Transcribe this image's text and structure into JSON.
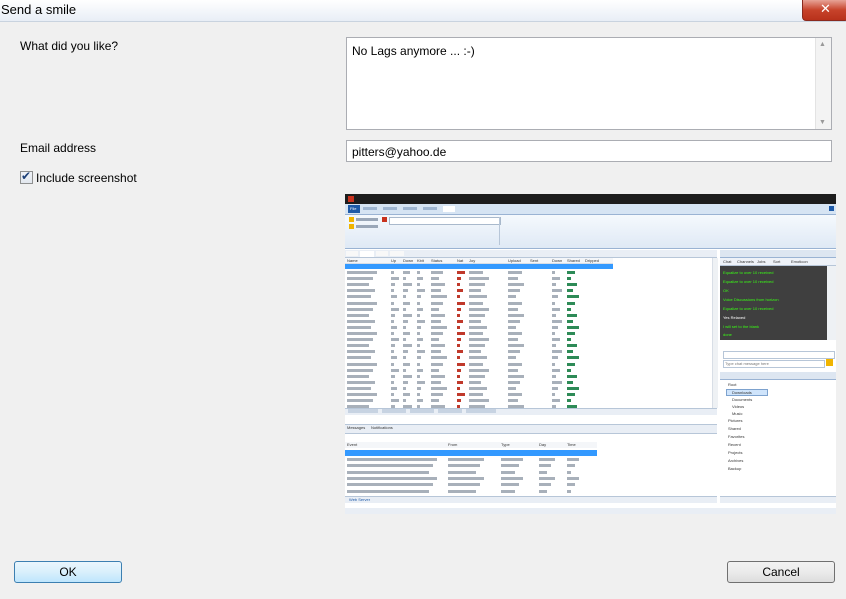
{
  "window": {
    "title": "Send a smile",
    "close_glyph": "✕"
  },
  "form": {
    "like_label": "What did you like?",
    "like_value": "No Lags anymore ... :-)",
    "email_label": "Email address",
    "email_value": "pitters@yahoo.de",
    "include_screenshot_label": "Include screenshot",
    "include_screenshot_checked": true
  },
  "buttons": {
    "ok": "OK",
    "cancel": "Cancel"
  },
  "screenshot": {
    "ribbon_tab_active": "File",
    "panel_tabs": [
      "Chat",
      "Channels",
      "Jobs",
      "Sort",
      "Emoticon"
    ],
    "table_headers": [
      "Name",
      "Up",
      "Down",
      "Kbit",
      "Status",
      "Nat",
      "Joy",
      "Upload",
      "Sent",
      "Down",
      "Shared",
      "Dripped"
    ],
    "chat_lines": [
      "Equalize to over 10 received",
      "Equalize to over 10 received",
      "OK",
      "Voice Discussions from horizon",
      "Equalize to over 10 received",
      "Yes Relaxed",
      "I will set to the blank",
      "done"
    ],
    "chat_input_placeholder": "Type chat message here",
    "event_tabs": [
      "Messages",
      "Notifications"
    ],
    "event_headers": [
      "Event",
      "From",
      "Type",
      "Day",
      "Time"
    ],
    "status_items": [
      "Web Server"
    ],
    "tree_items": [
      "Root",
      "Downloads",
      "Documents",
      "Videos",
      "Music",
      "Pictures",
      "Shared",
      "Favorites",
      "Recent",
      "Projects",
      "Archives",
      "Backup"
    ]
  }
}
